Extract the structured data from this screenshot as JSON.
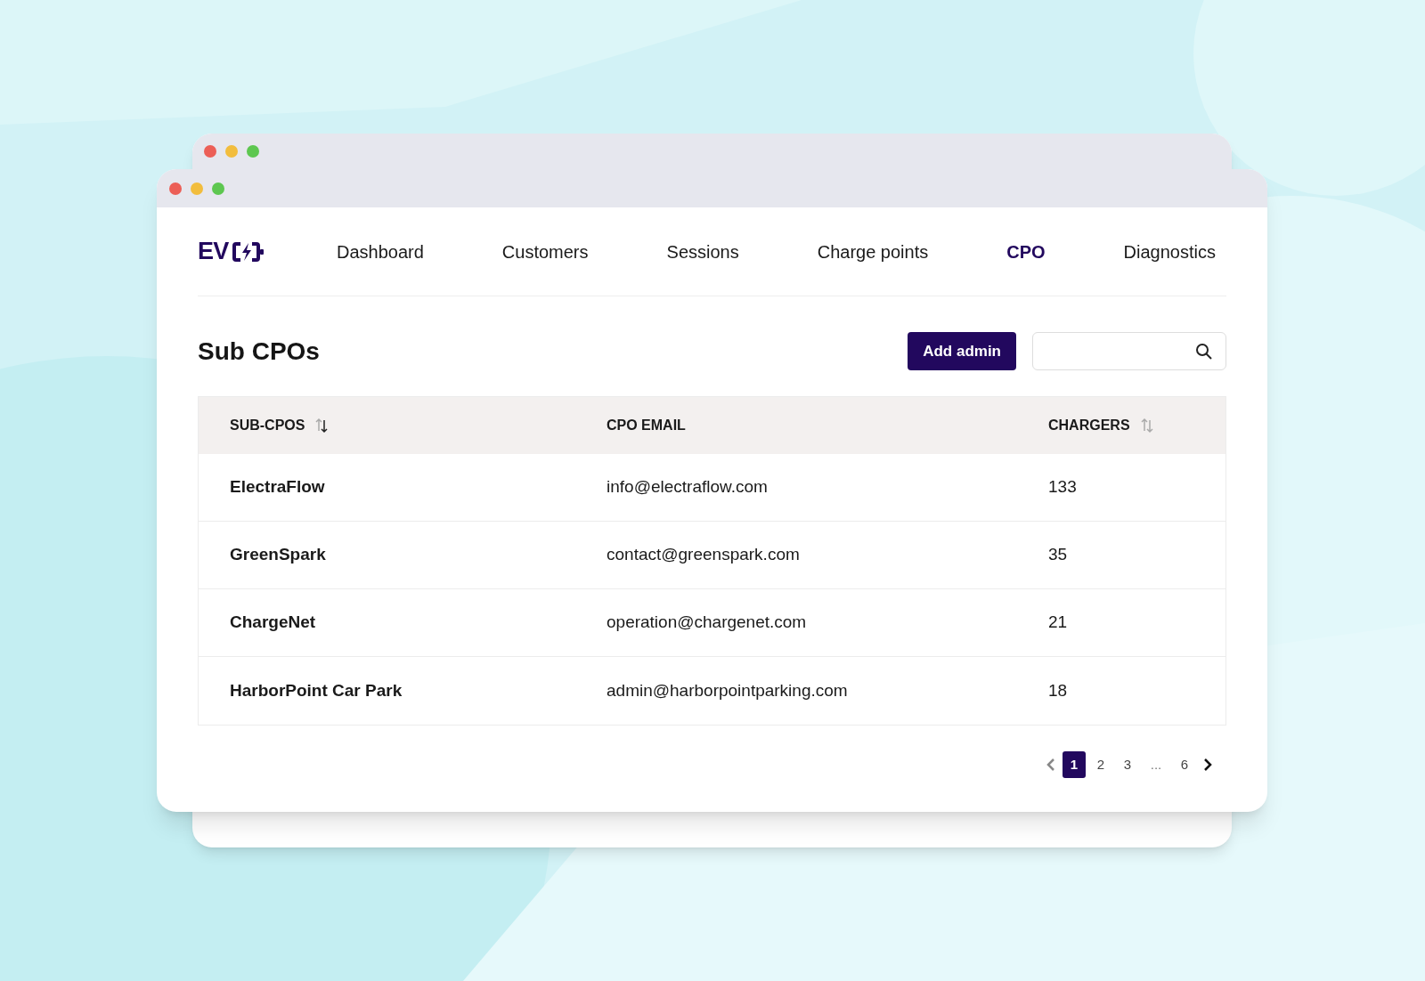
{
  "window": {
    "logo": "EV",
    "nav": [
      {
        "label": "Dashboard",
        "selected": false
      },
      {
        "label": "Customers",
        "selected": false
      },
      {
        "label": "Sessions",
        "selected": false
      },
      {
        "label": "Charge points",
        "selected": false
      },
      {
        "label": "CPO",
        "selected": true
      },
      {
        "label": "Diagnostics",
        "selected": false
      }
    ],
    "title": "Sub CPOs",
    "add_button": "Add admin",
    "table": {
      "columns": [
        {
          "label": "SUB-CPOS",
          "sortable": true,
          "sorted": true
        },
        {
          "label": "CPO EMAIL",
          "sortable": false
        },
        {
          "label": "CHARGERS",
          "sortable": true,
          "sorted": false
        }
      ],
      "rows": [
        [
          "ElectraFlow",
          "info@electraflow.com",
          "133"
        ],
        [
          "GreenSpark",
          "contact@greenspark.com",
          "35"
        ],
        [
          "ChargeNet",
          "operation@chargenet.com",
          "21"
        ],
        [
          "HarborPoint Car Park",
          "admin@harborpointparking.com",
          "18"
        ]
      ]
    },
    "pagination": {
      "pages": [
        {
          "label": "1",
          "selected": true
        },
        {
          "label": "2",
          "selected": false
        },
        {
          "label": "3",
          "selected": false
        },
        {
          "label": "...",
          "kind": "gap"
        },
        {
          "label": "6",
          "selected": false
        }
      ]
    }
  }
}
